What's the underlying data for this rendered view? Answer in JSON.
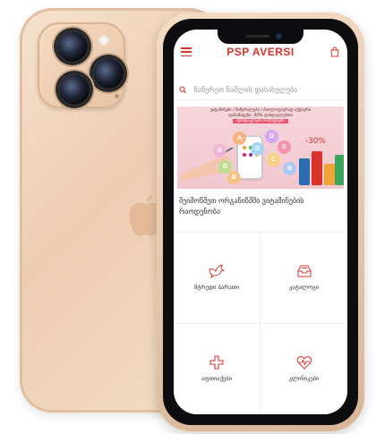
{
  "header": {
    "brand": "PSP AVERSI"
  },
  "search": {
    "placeholder": "ჩაწერეთ წამლის დასახელება"
  },
  "banner": {
    "line1": "ვიტამინები / მინერალები / ბიოლოგიურად აქტიური",
    "line2": "დანამატები -30% ფასდაკლებით",
    "line3": "ფასდაკლება მოქმედებს",
    "discount": "-30%",
    "bubbles": [
      "B",
      "A",
      "D",
      "B",
      "C",
      "B",
      "E",
      "B",
      "B"
    ],
    "caption": "შეიმოწმეთ ორგანიზმში ვიტამინების რაოდენობა"
  },
  "tiles": [
    {
      "label": "მტრედი ბარათი",
      "icon": "dove-icon"
    },
    {
      "label": "კატალოგი",
      "icon": "catalog-tray-icon"
    },
    {
      "label": "აფთიაქები",
      "icon": "pharmacy-cross-icon"
    },
    {
      "label": "კლინიკები",
      "icon": "heartbeat-icon"
    }
  ],
  "colors": {
    "accent": "#d9342b",
    "gold": "#ecd0b6"
  }
}
